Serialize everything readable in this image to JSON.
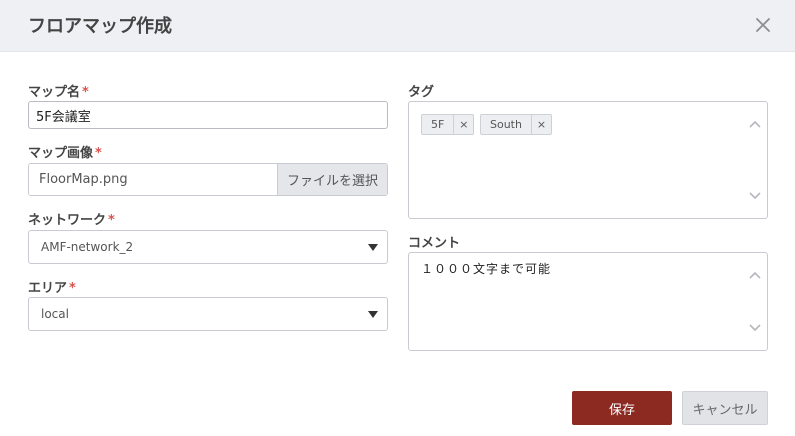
{
  "dialog": {
    "title": "フロアマップ作成"
  },
  "form": {
    "map_name": {
      "label": "マップ名",
      "required_mark": "*",
      "value": "5F会議室"
    },
    "map_image": {
      "label": "マップ画像",
      "required_mark": "*",
      "file_name": "FloorMap.png",
      "button_label": "ファイルを選択"
    },
    "network": {
      "label": "ネットワーク",
      "required_mark": "*",
      "selected": "AMF-network_2"
    },
    "area": {
      "label": "エリア",
      "required_mark": "*",
      "selected": "local"
    },
    "tags": {
      "label": "タグ",
      "items": [
        {
          "text": "5F"
        },
        {
          "text": "South"
        }
      ],
      "remove_glyph": "×"
    },
    "comment": {
      "label": "コメント",
      "value": "１０００文字まで可能"
    }
  },
  "footer": {
    "save_label": "保存",
    "cancel_label": "キャンセル"
  },
  "colors": {
    "header_bg": "#eff0f4",
    "required": "#d9534f",
    "save_bg": "#8c2a22",
    "cancel_bg": "#e1e3e7"
  },
  "icons": {
    "close": "close-icon",
    "select_caret": "caret-down-icon",
    "scroll_up": "chevron-up-icon",
    "scroll_down": "chevron-down-icon"
  }
}
